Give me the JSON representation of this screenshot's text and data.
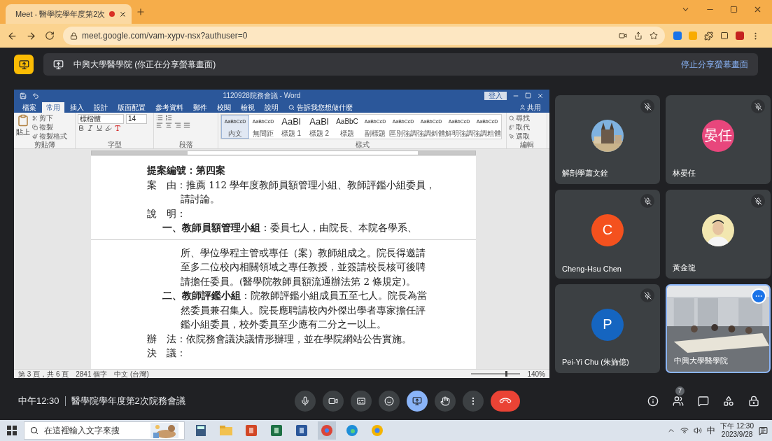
{
  "browser": {
    "tab_title": "Meet - 醫學院學年度第2次",
    "recording": true,
    "url": "meet.google.com/vam-xypv-nsx?authuser=0"
  },
  "presenting_bar": {
    "label": "中興大學醫學院 (你正在分享螢幕畫面)",
    "stop_label": "停止分享螢幕畫面"
  },
  "word": {
    "title": "1120928院務會議 - Word",
    "sign_in": "登入",
    "tabs": [
      {
        "label": "檔案",
        "selected": false
      },
      {
        "label": "常用",
        "selected": true
      },
      {
        "label": "插入",
        "selected": false
      },
      {
        "label": "設計",
        "selected": false
      },
      {
        "label": "版面配置",
        "selected": false
      },
      {
        "label": "參考資料",
        "selected": false
      },
      {
        "label": "郵件",
        "selected": false
      },
      {
        "label": "校閱",
        "selected": false
      },
      {
        "label": "檢視",
        "selected": false
      },
      {
        "label": "說明",
        "selected": false
      }
    ],
    "tell_me": "告訴我您想做什麼",
    "share": "共用",
    "clipboard": {
      "paste": "貼上",
      "cut": "剪下",
      "copy": "複製",
      "format_painter": "複製格式"
    },
    "font_name": "標楷體",
    "font_size": "14",
    "styles": [
      {
        "sample": "AaBbCcD",
        "label": "內文",
        "kind": "small",
        "selected": true
      },
      {
        "sample": "AaBbCcD",
        "label": "無間距",
        "kind": "small",
        "selected": false
      },
      {
        "sample": "AaBl",
        "label": "標題 1",
        "kind": "large",
        "selected": false
      },
      {
        "sample": "AaBl",
        "label": "標題 2",
        "kind": "large",
        "selected": false
      },
      {
        "sample": "AaBbC",
        "label": "標題",
        "kind": "medium",
        "selected": false
      },
      {
        "sample": "AaBbCcD",
        "label": "副標題",
        "kind": "small",
        "selected": false
      },
      {
        "sample": "AaBbCcD",
        "label": "區別強調",
        "kind": "small",
        "selected": false
      },
      {
        "sample": "AaBbCcD",
        "label": "強調斜體",
        "kind": "small",
        "selected": false
      },
      {
        "sample": "AaBbCcD",
        "label": "鮮明強調",
        "kind": "small",
        "selected": false
      },
      {
        "sample": "AaBbCcD",
        "label": "強調粗體",
        "kind": "small",
        "selected": false
      }
    ],
    "editing": {
      "find": "尋找",
      "replace": "取代",
      "select": "選取"
    },
    "groups": [
      "剪貼簿",
      "字型",
      "段落",
      "樣式",
      "編輯"
    ],
    "pages": [
      [
        {
          "kind": "heading",
          "text": "提案編號：第四案"
        },
        {
          "kind": "field",
          "text": "案　由：推薦 112 學年度教師員額管理小組、教師評鑑小組委員，"
        },
        {
          "kind": "cont",
          "text": "請討論。"
        },
        {
          "kind": "field",
          "text": "說　明："
        },
        {
          "kind": "item",
          "text": "**一、教師員額管理小組**：委員七人，由院長、本院各學系、"
        }
      ],
      [
        {
          "kind": "cont",
          "text": "所、學位學程主管或專任（案）教師組成之。院長得邀請"
        },
        {
          "kind": "cont",
          "text": "至多二位校內相關領域之專任教授，並簽請校長核可後聘"
        },
        {
          "kind": "cont",
          "text": "請擔任委員。(醫學院教師員額流通辦法第 2 條規定)。"
        },
        {
          "kind": "item",
          "text": "**二、教師評鑑小組**：院教師評鑑小組成員五至七人。院長為當"
        },
        {
          "kind": "cont",
          "text": "然委員兼召集人。院長應聘請校內外傑出學者專家擔任評"
        },
        {
          "kind": "cont",
          "text": "鑑小組委員，校外委員至少應有二分之一以上。"
        },
        {
          "kind": "field",
          "text": "辦　法：依院務會議決議情形辦理，並在學院網站公告實施。"
        },
        {
          "kind": "field",
          "text": "決　議："
        }
      ]
    ],
    "status": {
      "page": "第 3 頁，共 6 頁",
      "words": "2841 個字",
      "language": "中文 (台灣)",
      "zoom": "140%",
      "zoom_slider": {
        "level": 0.7
      }
    }
  },
  "tiles": [
    {
      "name": "解剖學蕭文銓",
      "muted": true,
      "highlighted": false
    },
    {
      "name": "林晏任",
      "muted": true,
      "highlighted": false,
      "avatar": {
        "kind": "letter",
        "text": "晏任",
        "color": "#e8467c"
      }
    },
    {
      "name": "Cheng-Hsu Chen",
      "muted": true,
      "highlighted": false,
      "avatar": {
        "kind": "letter",
        "text": "C",
        "color": "#f4511e"
      }
    },
    {
      "name": "黃金龍",
      "muted": true,
      "highlighted": false,
      "avatar": {
        "kind": "person"
      }
    },
    {
      "name": "Pei-Yi Chu (朱旆億)",
      "muted": true,
      "highlighted": false,
      "avatar": {
        "kind": "letter",
        "text": "P",
        "color": "#1565c0"
      }
    },
    {
      "name": "中興大學醫學院",
      "muted": false,
      "highlighted": true,
      "avatar": {
        "kind": "video"
      }
    }
  ],
  "call_bar": {
    "time": "中午12:30",
    "meeting": "醫學院學年度第2次院務會議",
    "presenting": true,
    "participants_count": "7"
  },
  "taskbar": {
    "search_placeholder": "在這裡輸入文字來搜",
    "ime": "中",
    "time": "下午 12:30",
    "date": "2023/9/28"
  }
}
